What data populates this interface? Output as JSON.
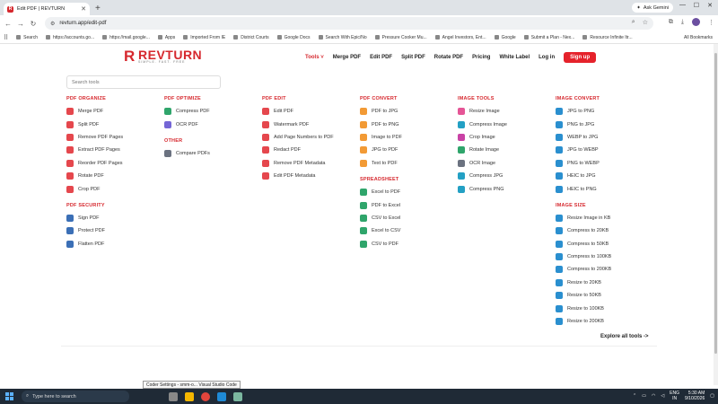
{
  "browser": {
    "tab_title": "Edit PDF | REVTURN",
    "favicon_letter": "R",
    "ask_gemini": "Ask Gemini",
    "url": "revturn.app/edit-pdf",
    "bookmarks": [
      "Search",
      "https://accounts.go...",
      "https://mail.google...",
      "Apps",
      "Imported From IE",
      "District Courts",
      "Google Docs",
      "Search With Epic/No",
      "Pressure Cooker Mu...",
      "Angel Investors, Ent...",
      "Google",
      "Submit a Plan - Nex...",
      "Resource Infinite Itr..."
    ],
    "all_bookmarks": "All Bookmarks"
  },
  "site": {
    "logo_word": "REVTURN",
    "logo_tagline": "SIMPLE. FAST. FREE",
    "nav": {
      "tools": "Tools",
      "merge": "Merge PDF",
      "edit": "Edit PDF",
      "split": "Split PDF",
      "rotate": "Rotate PDF",
      "pricing": "Pricing",
      "white_label": "White Label",
      "login": "Log in",
      "signup": "Sign up"
    },
    "search_placeholder": "Search tools",
    "explore_all": "Explore all tools ->"
  },
  "columns": [
    {
      "groups": [
        {
          "title": "PDF ORGANIZE",
          "items": [
            {
              "label": "Merge PDF",
              "color": "red"
            },
            {
              "label": "Split PDF",
              "color": "red"
            },
            {
              "label": "Remove PDF Pages",
              "color": "red"
            },
            {
              "label": "Extract PDF Pages",
              "color": "red"
            },
            {
              "label": "Reorder PDF Pages",
              "color": "red"
            },
            {
              "label": "Rotate PDF",
              "color": "red"
            },
            {
              "label": "Crop PDF",
              "color": "red"
            }
          ]
        },
        {
          "title": "PDF SECURITY",
          "items": [
            {
              "label": "Sign PDF",
              "color": "dark"
            },
            {
              "label": "Protect PDF",
              "color": "dark"
            },
            {
              "label": "Flatten PDF",
              "color": "dark"
            }
          ]
        }
      ]
    },
    {
      "groups": [
        {
          "title": "PDF OPTIMIZE",
          "items": [
            {
              "label": "Compress PDF",
              "color": "green"
            },
            {
              "label": "OCR PDF",
              "color": "purple"
            }
          ]
        },
        {
          "title": "OTHER",
          "items": [
            {
              "label": "Compare PDFs",
              "color": "gray"
            }
          ]
        }
      ]
    },
    {
      "groups": [
        {
          "title": "PDF EDIT",
          "items": [
            {
              "label": "Edit PDF",
              "color": "red"
            },
            {
              "label": "Watermark PDF",
              "color": "red"
            },
            {
              "label": "Add Page Numbers to PDF",
              "color": "red"
            },
            {
              "label": "Redact PDF",
              "color": "red"
            },
            {
              "label": "Remove PDF Metadata",
              "color": "red"
            },
            {
              "label": "Edit PDF Metadata",
              "color": "red"
            }
          ]
        }
      ]
    },
    {
      "groups": [
        {
          "title": "PDF CONVERT",
          "items": [
            {
              "label": "PDF to JPG",
              "color": "orange"
            },
            {
              "label": "PDF to PNG",
              "color": "orange"
            },
            {
              "label": "Image to PDF",
              "color": "orange"
            },
            {
              "label": "JPG to PDF",
              "color": "orange"
            },
            {
              "label": "Text to PDF",
              "color": "orange"
            }
          ]
        },
        {
          "title": "SPREADSHEET",
          "items": [
            {
              "label": "Excel to PDF",
              "color": "green"
            },
            {
              "label": "PDF to Excel",
              "color": "green"
            },
            {
              "label": "CSV to Excel",
              "color": "green"
            },
            {
              "label": "Excel to CSV",
              "color": "green"
            },
            {
              "label": "CSV to PDF",
              "color": "green"
            }
          ]
        }
      ]
    },
    {
      "groups": [
        {
          "title": "IMAGE TOOLS",
          "items": [
            {
              "label": "Resize Image",
              "color": "pink"
            },
            {
              "label": "Compress Image",
              "color": "teal"
            },
            {
              "label": "Crop Image",
              "color": "magenta"
            },
            {
              "label": "Rotate Image",
              "color": "green"
            },
            {
              "label": "OCR Image",
              "color": "gray"
            },
            {
              "label": "Compress JPG",
              "color": "teal"
            },
            {
              "label": "Compress PNG",
              "color": "teal"
            }
          ]
        }
      ]
    },
    {
      "groups": [
        {
          "title": "IMAGE CONVERT",
          "items": [
            {
              "label": "JPG to PNG",
              "color": "blue"
            },
            {
              "label": "PNG to JPG",
              "color": "blue"
            },
            {
              "label": "WEBP to JPG",
              "color": "blue"
            },
            {
              "label": "JPG to WEBP",
              "color": "blue"
            },
            {
              "label": "PNG to WEBP",
              "color": "blue"
            },
            {
              "label": "HEIC to JPG",
              "color": "blue"
            },
            {
              "label": "HEIC to PNG",
              "color": "blue"
            }
          ]
        },
        {
          "title": "IMAGE SIZE",
          "items": [
            {
              "label": "Resize Image in KB",
              "color": "blue"
            },
            {
              "label": "Compress to 20KB",
              "color": "blue"
            },
            {
              "label": "Compress to 50KB",
              "color": "blue"
            },
            {
              "label": "Compress to 100KB",
              "color": "blue"
            },
            {
              "label": "Compress to 200KB",
              "color": "blue"
            },
            {
              "label": "Resize to 20KB",
              "color": "blue"
            },
            {
              "label": "Resize to 50KB",
              "color": "blue"
            },
            {
              "label": "Resize to 100KB",
              "color": "blue"
            },
            {
              "label": "Resize to 200KB",
              "color": "blue"
            }
          ]
        }
      ]
    }
  ],
  "taskbar": {
    "search_placeholder": "Type here to search",
    "tooltip": "Coder Settings - smm-o... Visual Studio Code",
    "lang_top": "ENG",
    "lang_bottom": "IN",
    "time": "5:30 AM",
    "date": "9/10/2026"
  }
}
